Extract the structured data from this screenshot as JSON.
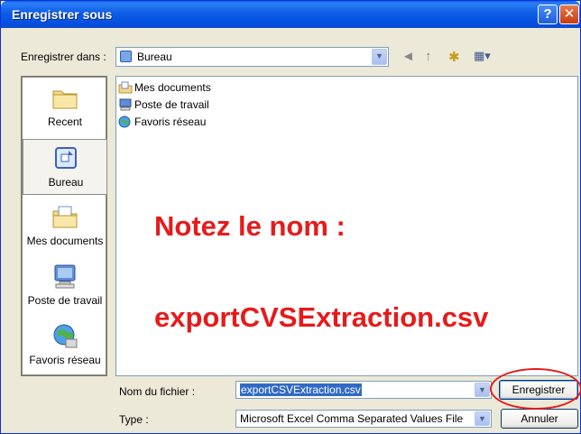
{
  "window": {
    "title": "Enregistrer sous",
    "help_glyph": "?",
    "close_glyph": "✕"
  },
  "save_in": {
    "label": "Enregistrer dans :",
    "value": "Bureau"
  },
  "toolbar": {
    "back_glyph": "◄",
    "up_glyph": "↑",
    "new_folder_glyph": "✱",
    "views_glyph": "▦▾"
  },
  "places": [
    {
      "label": "Recent",
      "icon": "recent-folder-icon"
    },
    {
      "label": "Bureau",
      "icon": "desktop-icon"
    },
    {
      "label": "Mes documents",
      "icon": "my-documents-icon"
    },
    {
      "label": "Poste de travail",
      "icon": "my-computer-icon"
    },
    {
      "label": "Favoris réseau",
      "icon": "network-places-icon"
    }
  ],
  "files": [
    {
      "label": "Mes documents",
      "icon": "my-documents-icon"
    },
    {
      "label": "Poste de travail",
      "icon": "my-computer-icon"
    },
    {
      "label": "Favoris réseau",
      "icon": "network-places-icon"
    }
  ],
  "annotation": {
    "line1": "Notez le nom :",
    "line2": "exportCVSExtraction.csv"
  },
  "filename": {
    "label": "Nom du fichier :",
    "value": "exportCSVExtraction.csv"
  },
  "filetype": {
    "label": "Type :",
    "value": "Microsoft Excel Comma Separated Values File"
  },
  "buttons": {
    "save": "Enregistrer",
    "cancel": "Annuler"
  },
  "colors": {
    "titlebar": "#0A5FE8",
    "annotation": "#E51B1B",
    "dialog_bg": "#ECE9D8"
  }
}
